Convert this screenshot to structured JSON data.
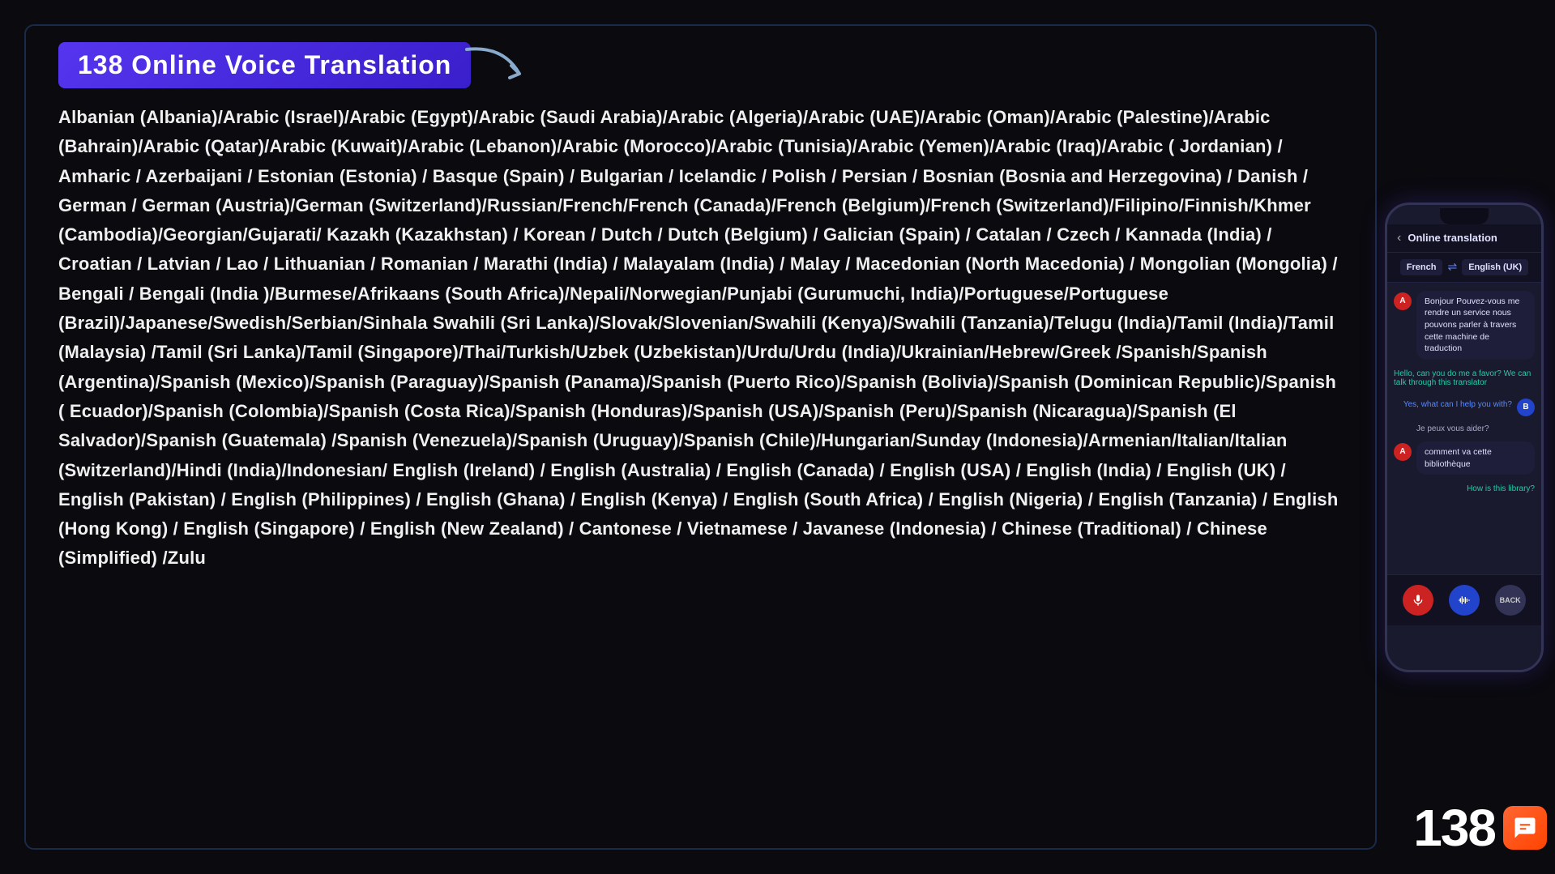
{
  "title": "138 Online Voice Translation",
  "languages_text": "Albanian (Albania)/Arabic (Israel)/Arabic (Egypt)/Arabic (Saudi Arabia)/Arabic (Algeria)/Arabic (UAE)/Arabic (Oman)/Arabic (Palestine)/Arabic (Bahrain)/Arabic (Qatar)/Arabic (Kuwait)/Arabic (Lebanon)/Arabic (Morocco)/Arabic (Tunisia)/Arabic (Yemen)/Arabic (Iraq)/Arabic ( Jordanian) / Amharic / Azerbaijani / Estonian (Estonia) / Basque (Spain) / Bulgarian / Icelandic / Polish / Persian / Bosnian (Bosnia and Herzegovina) / Danish / German / German (Austria)/German (Switzerland)/Russian/French/French (Canada)/French (Belgium)/French (Switzerland)/Filipino/Finnish/Khmer (Cambodia)/Georgian/Gujarati/ Kazakh (Kazakhstan) / Korean / Dutch / Dutch (Belgium) / Galician (Spain) / Catalan / Czech / Kannada (India) / Croatian / Latvian / Lao / Lithuanian / Romanian / Marathi (India) / Malayalam (India) / Malay / Macedonian (North Macedonia) / Mongolian (Mongolia) / Bengali / Bengali (India )/Burmese/Afrikaans (South Africa)/Nepali/Norwegian/Punjabi (Gurumuchi, India)/Portuguese/Portuguese (Brazil)/Japanese/Swedish/Serbian/Sinhala Swahili (Sri Lanka)/Slovak/Slovenian/Swahili (Kenya)/Swahili (Tanzania)/Telugu (India)/Tamil (India)/Tamil (Malaysia) /Tamil (Sri Lanka)/Tamil (Singapore)/Thai/Turkish/Uzbek (Uzbekistan)/Urdu/Urdu (India)/Ukrainian/Hebrew/Greek /Spanish/Spanish (Argentina)/Spanish (Mexico)/Spanish (Paraguay)/Spanish (Panama)/Spanish (Puerto Rico)/Spanish (Bolivia)/Spanish (Dominican Republic)/Spanish ( Ecuador)/Spanish (Colombia)/Spanish (Costa Rica)/Spanish (Honduras)/Spanish (USA)/Spanish (Peru)/Spanish (Nicaragua)/Spanish (El Salvador)/Spanish (Guatemala) /Spanish (Venezuela)/Spanish (Uruguay)/Spanish (Chile)/Hungarian/Sunday (Indonesia)/Armenian/Italian/Italian (Switzerland)/Hindi (India)/Indonesian/ English (Ireland) / English (Australia) / English (Canada) / English (USA) / English (India) / English (UK) / English (Pakistan) / English (Philippines) / English (Ghana) / English (Kenya) / English (South Africa) / English (Nigeria) / English (Tanzania) / English (Hong Kong) / English (Singapore) / English (New Zealand) / Cantonese / Vietnamese / Javanese (Indonesia) / Chinese (Traditional) / Chinese (Simplified) /Zulu",
  "phone": {
    "header_title": "Online translation",
    "lang_from": "French",
    "lang_to": "English (UK)",
    "messages": [
      {
        "side": "left",
        "avatar": "A",
        "text": "Bonjour Pouvez-vous me rendre un service nous pouvons parler à travers cette machine de traduction"
      },
      {
        "side": "right_teal",
        "text": "Hello, can you do me a favor? We can talk through this translator"
      },
      {
        "side": "right_blue",
        "text": "Yes, what can I help you with?"
      },
      {
        "side": "left_translate",
        "text": "Je peux vous aider?"
      },
      {
        "side": "left",
        "avatar": "A",
        "text": "comment va cette bibliothèque"
      },
      {
        "side": "right_teal",
        "text": "How is this library?"
      }
    ],
    "controls": [
      "mic",
      "wave",
      "back"
    ],
    "back_label": "BACK"
  },
  "badge": {
    "number": "138",
    "icon": "💬"
  },
  "colors": {
    "title_bg": "#4a2aff",
    "background": "#0a0a0f",
    "text_primary": "#f0f0f0",
    "teal": "#22ccaa",
    "blue_msg": "#5588ff",
    "phone_bg": "#1a1a2e"
  }
}
